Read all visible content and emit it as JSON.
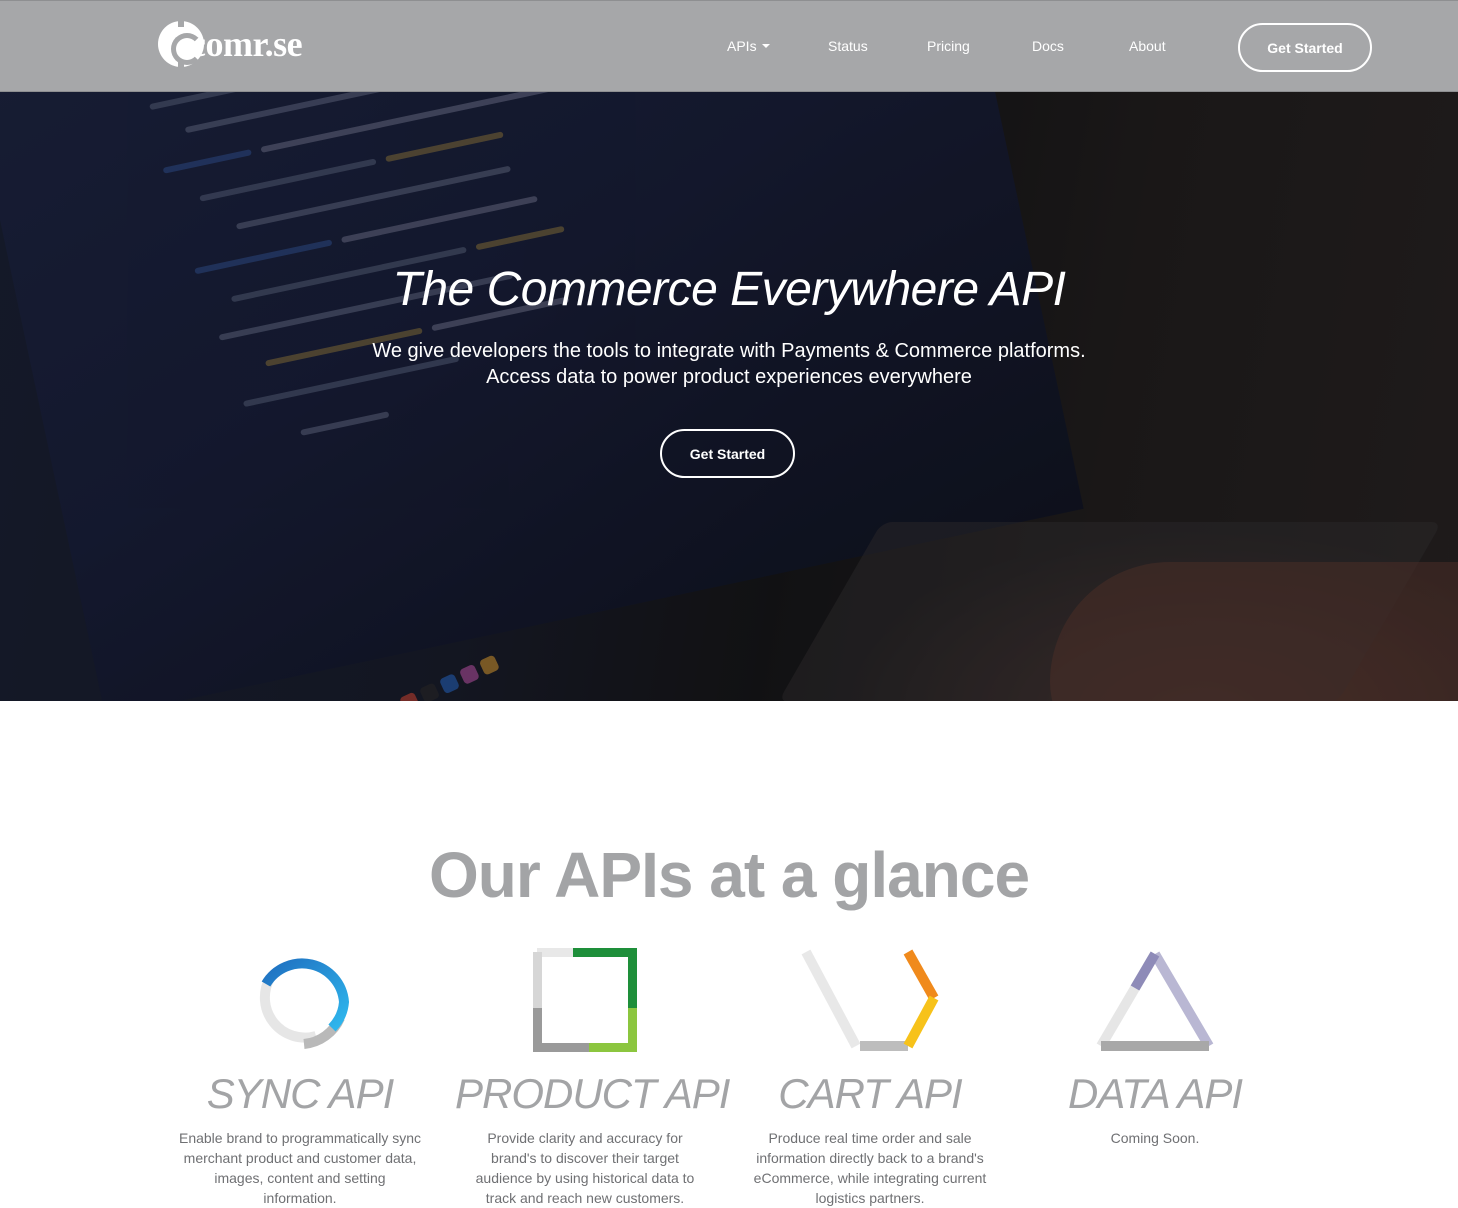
{
  "brand": {
    "name": "comr.se",
    "logo_icon": "comrse-logo-icon"
  },
  "nav": {
    "items": [
      {
        "label": "APIs",
        "has_caret": true
      },
      {
        "label": "Status"
      },
      {
        "label": "Pricing"
      },
      {
        "label": "Docs"
      },
      {
        "label": "About"
      }
    ],
    "cta_label": "Get Started"
  },
  "hero": {
    "title": "The Commerce Everywhere API",
    "subtitle_line1": "We give developers the tools to integrate with Payments & Commerce platforms.",
    "subtitle_line2": "Access data to power product experiences everywhere",
    "cta_label": "Get Started"
  },
  "apis": {
    "title": "Our APIs at a glance",
    "cards": [
      {
        "name": "SYNC API",
        "icon": "sync-api-icon",
        "description": "Enable brand to programmatically sync merchant product and customer data, images, content and setting information."
      },
      {
        "name": "PRODUCT API",
        "icon": "product-api-icon",
        "description": "Provide clarity and accuracy for brand's to discover their target audience by using historical data to track and reach new customers."
      },
      {
        "name": "CART API",
        "icon": "cart-api-icon",
        "description": "Produce real time order and sale information directly back to a brand's eCommerce, while integrating current logistics partners."
      },
      {
        "name": "DATA API",
        "icon": "data-api-icon",
        "description": "Coming Soon."
      }
    ]
  },
  "colors": {
    "nav_bg": "#a6a7a9",
    "heading_gray": "#a3a4a6",
    "sync_blue": "#2aa6e0",
    "product_green": "#2e9b3c",
    "cart_orange": "#f39a1f",
    "data_purple": "#9c9ac0"
  }
}
